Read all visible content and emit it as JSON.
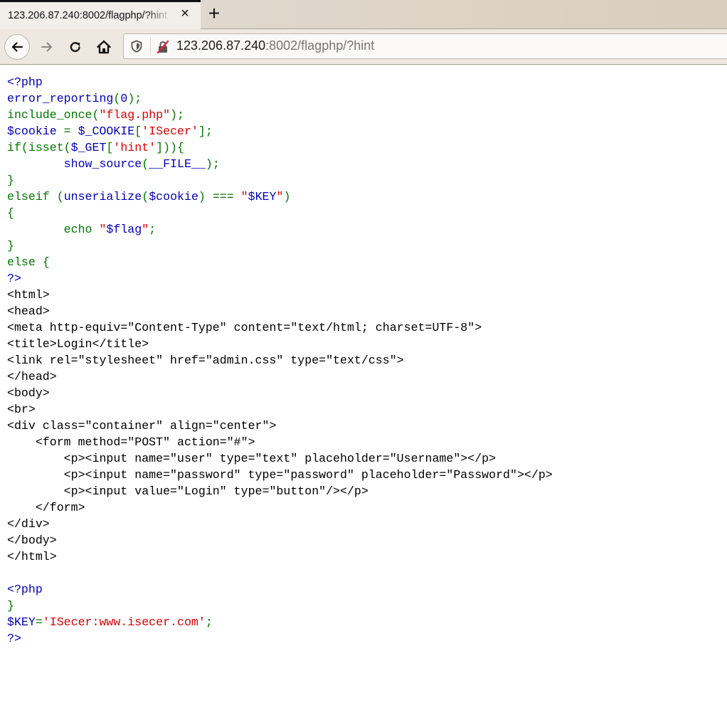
{
  "browser": {
    "tab": {
      "title": "123.206.87.240:8002/flagphp/?hint",
      "close_icon": "×"
    },
    "new_tab_icon": "+",
    "nav": {
      "back_icon": "arrow-left",
      "forward_icon": "arrow-right",
      "reload_icon": "reload",
      "home_icon": "home"
    },
    "url": {
      "host": "123.206.87.240",
      "rest": ":8002/flagphp/?hint"
    }
  },
  "colors": {
    "default": "#0000BB",
    "keyword": "#007700",
    "string": "#DD0000",
    "html": "#000000"
  },
  "source_lines": [
    [
      {
        "t": "<?php",
        "c": "default"
      }
    ],
    [
      {
        "t": "error_reporting",
        "c": "default"
      },
      {
        "t": "(",
        "c": "keyword"
      },
      {
        "t": "0",
        "c": "default"
      },
      {
        "t": ");",
        "c": "keyword"
      }
    ],
    [
      {
        "t": "include_once",
        "c": "keyword"
      },
      {
        "t": "(",
        "c": "keyword"
      },
      {
        "t": "\"flag.php\"",
        "c": "string"
      },
      {
        "t": ");",
        "c": "keyword"
      }
    ],
    [
      {
        "t": "$cookie ",
        "c": "default"
      },
      {
        "t": "= ",
        "c": "keyword"
      },
      {
        "t": "$_COOKIE",
        "c": "default"
      },
      {
        "t": "[",
        "c": "keyword"
      },
      {
        "t": "'ISecer'",
        "c": "string"
      },
      {
        "t": "];",
        "c": "keyword"
      }
    ],
    [
      {
        "t": "if(isset(",
        "c": "keyword"
      },
      {
        "t": "$_GET",
        "c": "default"
      },
      {
        "t": "[",
        "c": "keyword"
      },
      {
        "t": "'hint'",
        "c": "string"
      },
      {
        "t": "])){",
        "c": "keyword"
      }
    ],
    [
      {
        "t": "        ",
        "c": "html"
      },
      {
        "t": "show_source",
        "c": "default"
      },
      {
        "t": "(",
        "c": "keyword"
      },
      {
        "t": "__FILE__",
        "c": "default"
      },
      {
        "t": ");",
        "c": "keyword"
      }
    ],
    [
      {
        "t": "}",
        "c": "keyword"
      }
    ],
    [
      {
        "t": "elseif ",
        "c": "keyword"
      },
      {
        "t": "(",
        "c": "keyword"
      },
      {
        "t": "unserialize",
        "c": "default"
      },
      {
        "t": "(",
        "c": "keyword"
      },
      {
        "t": "$cookie",
        "c": "default"
      },
      {
        "t": ") === ",
        "c": "keyword"
      },
      {
        "t": "\"",
        "c": "string"
      },
      {
        "t": "$KEY",
        "c": "default"
      },
      {
        "t": "\"",
        "c": "string"
      },
      {
        "t": ")",
        "c": "keyword"
      }
    ],
    [
      {
        "t": "{",
        "c": "keyword"
      }
    ],
    [
      {
        "t": "        echo ",
        "c": "keyword"
      },
      {
        "t": "\"",
        "c": "string"
      },
      {
        "t": "$flag",
        "c": "default"
      },
      {
        "t": "\"",
        "c": "string"
      },
      {
        "t": ";",
        "c": "keyword"
      }
    ],
    [
      {
        "t": "}",
        "c": "keyword"
      }
    ],
    [
      {
        "t": "else ",
        "c": "keyword"
      },
      {
        "t": "{",
        "c": "keyword"
      }
    ],
    [
      {
        "t": "?>",
        "c": "default"
      }
    ],
    [
      {
        "t": "<html>",
        "c": "html"
      }
    ],
    [
      {
        "t": "<head>",
        "c": "html"
      }
    ],
    [
      {
        "t": "<meta http-equiv=\"Content-Type\" content=\"text/html; charset=UTF-8\">",
        "c": "html"
      }
    ],
    [
      {
        "t": "<title>Login</title>",
        "c": "html"
      }
    ],
    [
      {
        "t": "<link rel=\"stylesheet\" href=\"admin.css\" type=\"text/css\">",
        "c": "html"
      }
    ],
    [
      {
        "t": "</head>",
        "c": "html"
      }
    ],
    [
      {
        "t": "<body>",
        "c": "html"
      }
    ],
    [
      {
        "t": "<br>",
        "c": "html"
      }
    ],
    [
      {
        "t": "<div class=\"container\" align=\"center\">",
        "c": "html"
      }
    ],
    [
      {
        "t": "    <form method=\"POST\" action=\"#\">",
        "c": "html"
      }
    ],
    [
      {
        "t": "        <p><input name=\"user\" type=\"text\" placeholder=\"Username\"></p>",
        "c": "html"
      }
    ],
    [
      {
        "t": "        <p><input name=\"password\" type=\"password\" placeholder=\"Password\"></p>",
        "c": "html"
      }
    ],
    [
      {
        "t": "        <p><input value=\"Login\" type=\"button\"/></p>",
        "c": "html"
      }
    ],
    [
      {
        "t": "    </form>",
        "c": "html"
      }
    ],
    [
      {
        "t": "</div>",
        "c": "html"
      }
    ],
    [
      {
        "t": "</body>",
        "c": "html"
      }
    ],
    [
      {
        "t": "</html>",
        "c": "html"
      }
    ],
    [],
    [
      {
        "t": "<?php",
        "c": "default"
      }
    ],
    [
      {
        "t": "}",
        "c": "keyword"
      }
    ],
    [
      {
        "t": "$KEY",
        "c": "default"
      },
      {
        "t": "=",
        "c": "keyword"
      },
      {
        "t": "'ISecer:www.isecer.com'",
        "c": "string"
      },
      {
        "t": ";",
        "c": "keyword"
      }
    ],
    [
      {
        "t": "?>",
        "c": "default"
      }
    ]
  ]
}
